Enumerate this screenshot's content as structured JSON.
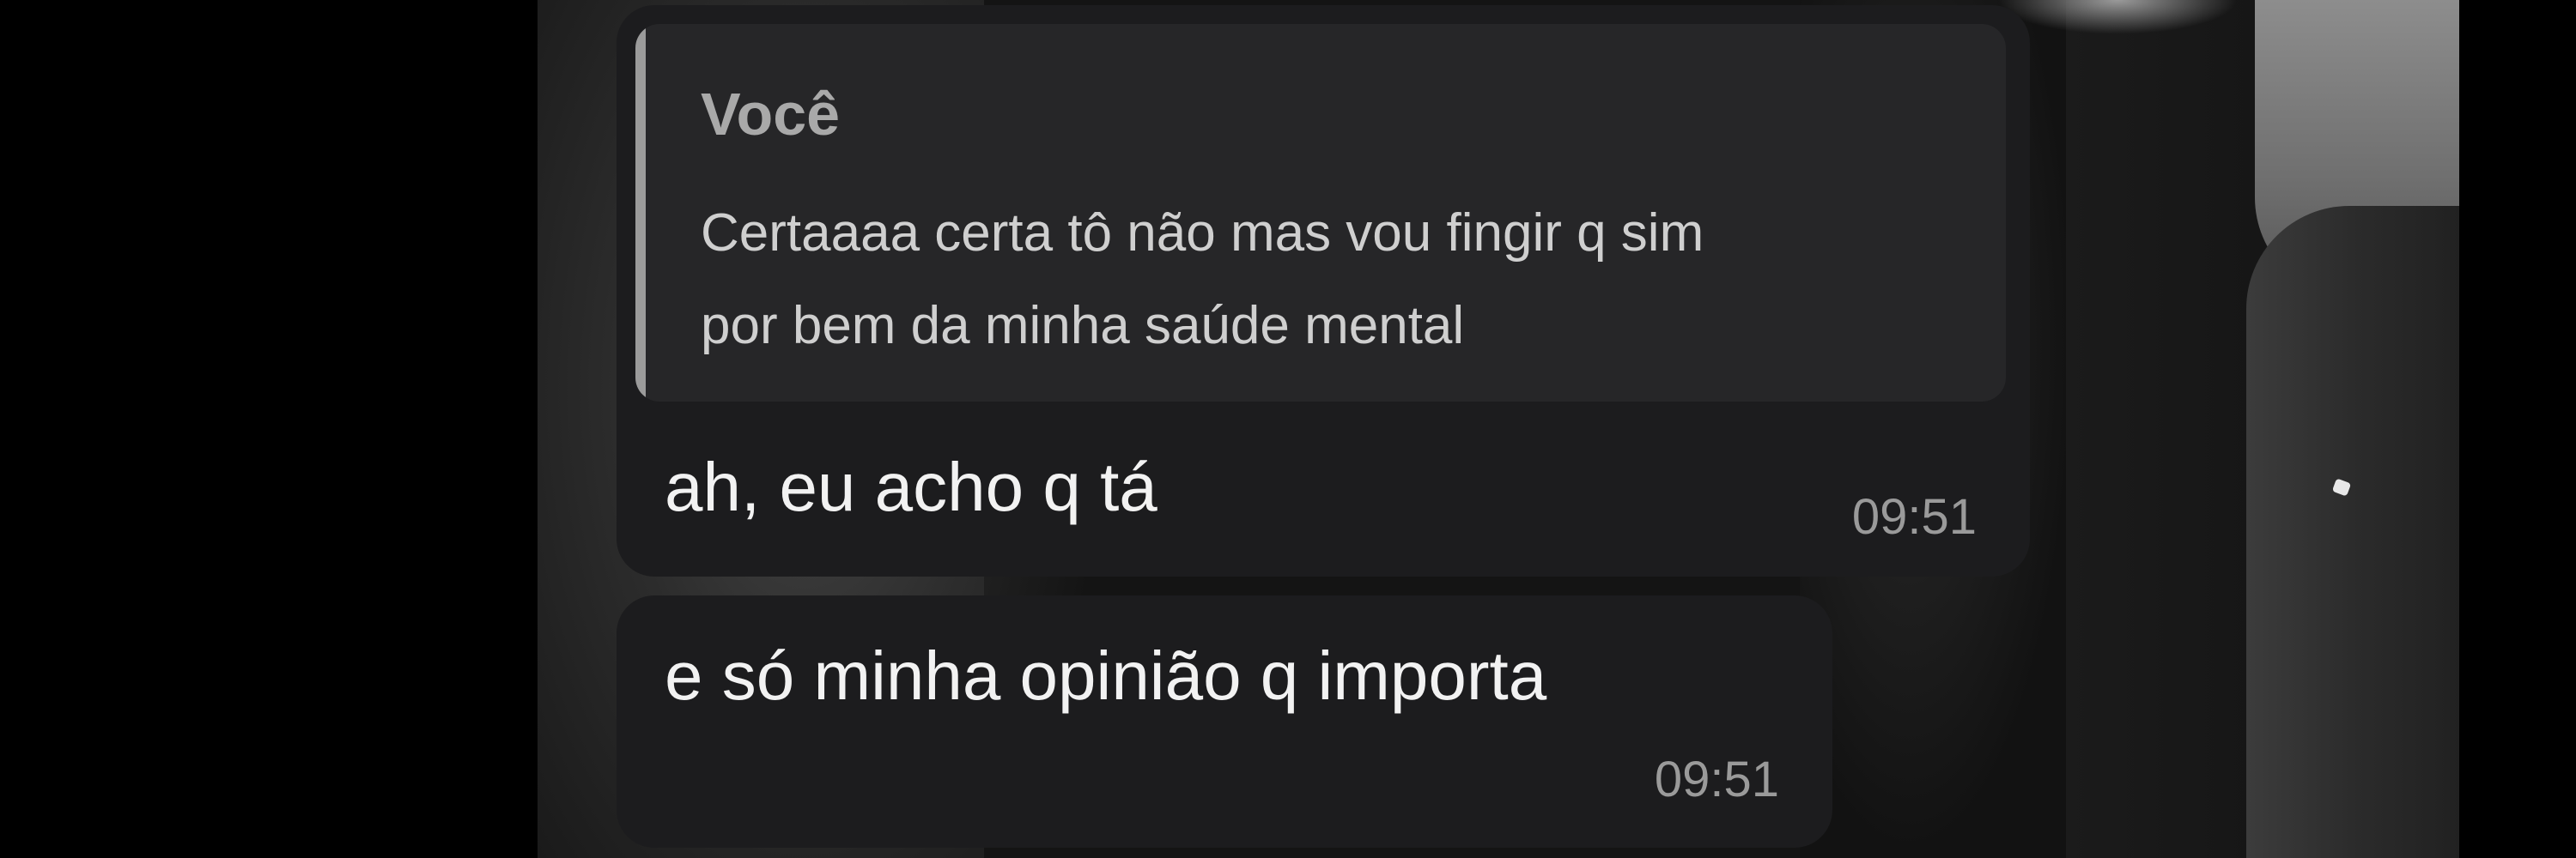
{
  "conversation": {
    "messages": [
      {
        "reply_to": {
          "author": "Você",
          "lines": [
            "Certaaaa certa tô não mas vou fingir q sim",
            "por bem da minha saúde mental"
          ]
        },
        "text": "ah, eu acho q tá",
        "time": "09:51"
      },
      {
        "text": "e só minha opinião q importa",
        "time": "09:51"
      }
    ]
  },
  "colors": {
    "page_background": "#000000",
    "bubble_background": "#1c1c1e",
    "quote_background": "#262628",
    "quote_bar": "#9b9b9b",
    "message_text": "#f2f2f2",
    "timestamp_text": "#9a9a9a"
  }
}
